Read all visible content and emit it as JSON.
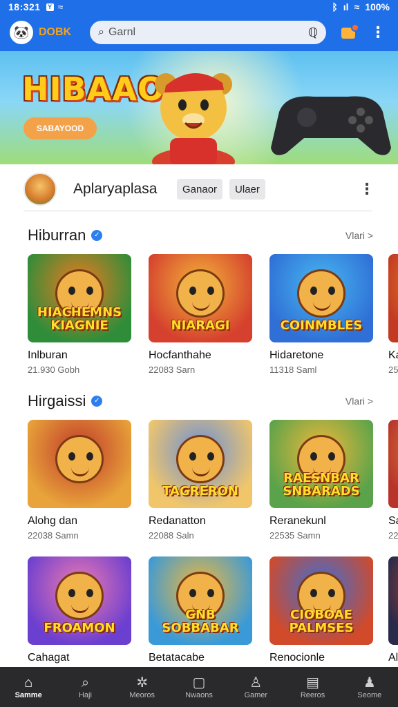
{
  "status": {
    "time": "18:321",
    "battery": "100%"
  },
  "appbar": {
    "brand": "DOBK",
    "search_placeholder": "Garnl"
  },
  "banner": {
    "title": "HIBAAO",
    "pill": "SABAYOOD"
  },
  "profile": {
    "name": "Aplaryaplasa",
    "chip1": "Ganaor",
    "chip2": "Ulaer"
  },
  "sections": [
    {
      "title": "Hiburran",
      "more": "Vlari >",
      "cards": [
        {
          "title": "Inlburan",
          "meta": "21.930 Gobh",
          "stamp": "HIACHEMNS KIAGNIE",
          "bg": "#2f8d3a",
          "accent": "#f07a1e"
        },
        {
          "title": "Hocfanthahe",
          "meta": "22083 Sarn",
          "stamp": "NIARAGI",
          "bg": "#d5412e",
          "accent": "#f3b43a"
        },
        {
          "title": "Hidaretone",
          "meta": "11318 Saml",
          "stamp": "COINMBLES",
          "bg": "#2f6fd6",
          "accent": "#48b8f0"
        },
        {
          "title": "Ka",
          "meta": "25",
          "stamp": "",
          "bg": "#c23a22",
          "accent": "#f39a2a"
        }
      ]
    },
    {
      "title": "Hirgaissi",
      "more": "Vlari >",
      "cards": [
        {
          "title": "Alohg dan",
          "meta": "22038 Samn",
          "stamp": "",
          "bg": "#e8a43a",
          "accent": "#c0392b"
        },
        {
          "title": "Redanatton",
          "meta": "22088 Saln",
          "stamp": "TAGRERON",
          "bg": "#f1c66b",
          "accent": "#6a8fd8"
        },
        {
          "title": "Reranekunl",
          "meta": "22535 Samn",
          "stamp": "RAESNBAR SNBARADS",
          "bg": "#5aa34a",
          "accent": "#f2b83a"
        },
        {
          "title": "Sa",
          "meta": "22",
          "stamp": "",
          "bg": "#b8342b",
          "accent": "#e3a03a"
        }
      ]
    },
    {
      "title": "",
      "more": "",
      "cards": [
        {
          "title": "Cahagat",
          "meta": "",
          "stamp": "FROAMON",
          "bg": "#6b3fd0",
          "accent": "#f07ab0"
        },
        {
          "title": "Betatacabe",
          "meta": "",
          "stamp": "GNB SOBBABAR",
          "bg": "#3a9ad8",
          "accent": "#f2b83a"
        },
        {
          "title": "Renocionle",
          "meta": "",
          "stamp": "CIOBOAE PALMSES",
          "bg": "#d14a2a",
          "accent": "#3a6fd8"
        },
        {
          "title": "Al",
          "meta": "",
          "stamp": "",
          "bg": "#2a2a4a",
          "accent": "#d14a2a"
        }
      ]
    }
  ],
  "nav": [
    {
      "label": "Samme",
      "icon": "home-icon",
      "glyph": "⌂",
      "active": true
    },
    {
      "label": "Haji",
      "icon": "search-icon",
      "glyph": "⌕",
      "active": false
    },
    {
      "label": "Meoros",
      "icon": "compass-icon",
      "glyph": "✲",
      "active": false
    },
    {
      "label": "Nwaons",
      "icon": "screen-icon",
      "glyph": "▢",
      "active": false
    },
    {
      "label": "Gamer",
      "icon": "badge-icon",
      "glyph": "♙",
      "active": false
    },
    {
      "label": "Reeros",
      "icon": "library-icon",
      "glyph": "▤",
      "active": false
    },
    {
      "label": "Seome",
      "icon": "profile-icon",
      "glyph": "♟",
      "active": false
    }
  ]
}
